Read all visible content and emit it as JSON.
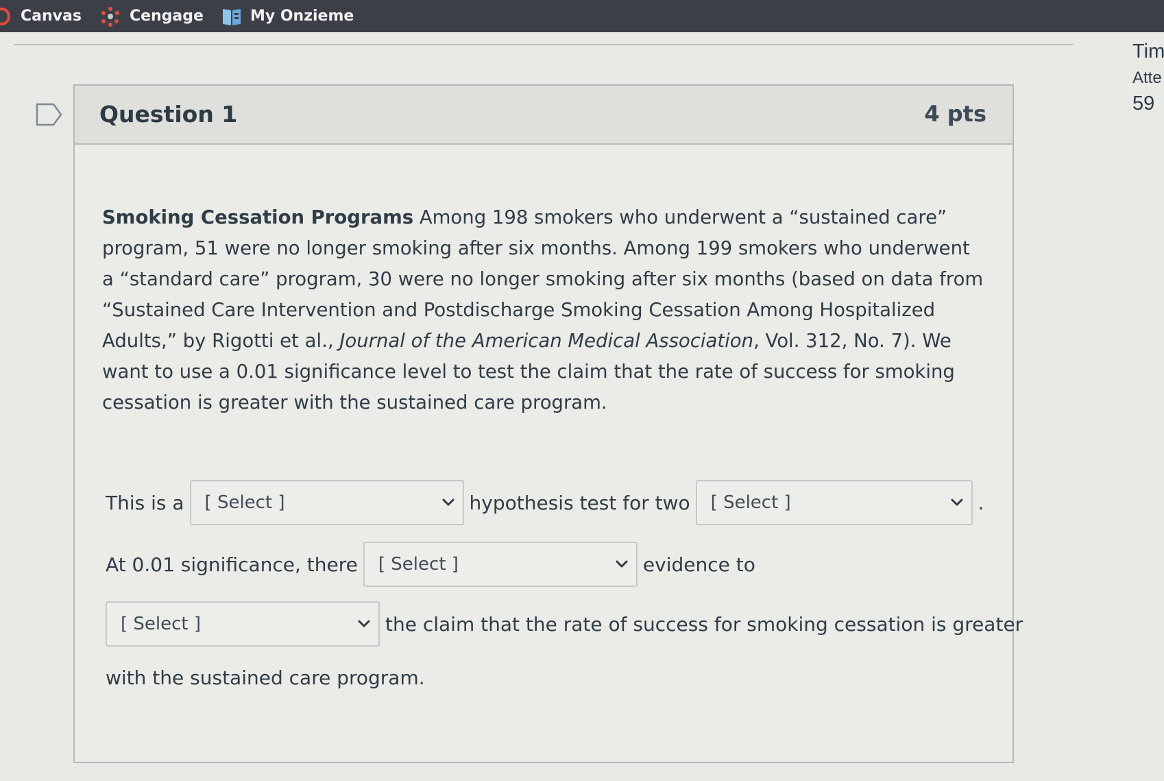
{
  "bookmarks": [
    {
      "label": "Canvas",
      "icon": "canvas-icon"
    },
    {
      "label": "Cengage",
      "icon": "cengage-icon"
    },
    {
      "label": "My Onzieme",
      "icon": "book-icon"
    }
  ],
  "sidebar": {
    "time_label": "Tim",
    "attempt_label": "Atte",
    "time_value": "59"
  },
  "question": {
    "title": "Question 1",
    "points": "4 pts",
    "body": {
      "lead": "Smoking Cessation Programs",
      "text_part1": " Among 198 smokers who underwent a “sustained care” program, 51 were no longer smoking after six months. Among 199 smokers who underwent a “standard care” program, 30 were no longer smoking after six months (based on data from “Sustained Care Intervention and Postdischarge Smoking Cessation Among Hospitalized Adults,” by Rigotti et al., ",
      "journal": "Journal of the American Medical Association",
      "text_part2": ", Vol. 312, No. 7). We want to use a 0.01 significance level to test the claim that the rate of success for smoking cessation is greater with the sustained care program."
    },
    "row1": {
      "prefix": "This is a",
      "select1": "[ Select ]",
      "middle": "hypothesis test for two",
      "select2": "[ Select ]",
      "suffix": "."
    },
    "row2": {
      "prefix": "At 0.01 significance, there",
      "select": "[ Select ]",
      "suffix": "evidence to"
    },
    "row3": {
      "select": "[ Select ]",
      "suffix": "the claim that the rate of success for smoking cessation is greater"
    },
    "row4": {
      "text": "with the sustained care program."
    }
  },
  "colors": {
    "bookmarks_bar": "#3c3f48",
    "page_background": "#e9e9e6",
    "card_header": "#dfdfdc",
    "text": "#2d3b45"
  }
}
